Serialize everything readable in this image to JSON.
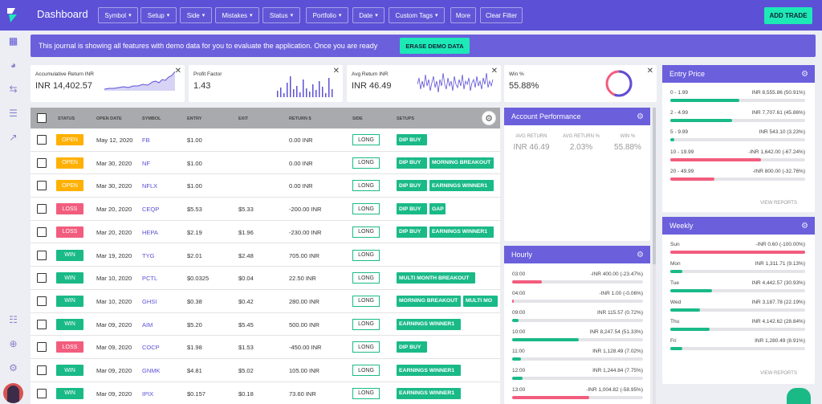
{
  "header": {
    "title": "Dashboard",
    "nav": [
      "Symbol",
      "Setup",
      "Side",
      "Mistakes",
      "Status",
      "Portfolio",
      "Date",
      "Custom Tags",
      "More",
      "Clear Filter"
    ],
    "add_trade": "ADD TRADE"
  },
  "banner": {
    "text": "This journal is showing all features with demo data for you to evaluate the application. Once you are ready",
    "button": "ERASE DEMO DATA"
  },
  "widgets": [
    {
      "label": "Accumulative Return INR",
      "value": "INR 14,402.57"
    },
    {
      "label": "Profit Factor",
      "value": "1.43"
    },
    {
      "label": "Avg Return INR",
      "value": "INR 46.49"
    },
    {
      "label": "Win %",
      "value": "55.88%"
    }
  ],
  "win_pct": 55.88,
  "table": {
    "headers": [
      "STATUS",
      "OPEN DATE",
      "SYMBOL",
      "ENTRY",
      "EXIT",
      "RETURN $",
      "SIDE",
      "SETUPS"
    ],
    "rows": [
      {
        "status": "OPEN",
        "date": "May 12, 2020",
        "symbol": "FB",
        "entry": "$1.00",
        "exit": "",
        "ret": "0.00 INR",
        "side": "LONG",
        "setups": [
          "DIP BUY"
        ]
      },
      {
        "status": "OPEN",
        "date": "Mar 30, 2020",
        "symbol": "NF",
        "entry": "$1.00",
        "exit": "",
        "ret": "0.00 INR",
        "side": "LONG",
        "setups": [
          "DIP BUY",
          "MORNING BREAKOUT"
        ]
      },
      {
        "status": "OPEN",
        "date": "Mar 30, 2020",
        "symbol": "NFLX",
        "entry": "$1.00",
        "exit": "",
        "ret": "0.00 INR",
        "side": "LONG",
        "setups": [
          "DIP BUY",
          "EARNINGS WINNER1"
        ]
      },
      {
        "status": "LOSS",
        "date": "Mar 20, 2020",
        "symbol": "CEQP",
        "entry": "$5.53",
        "exit": "$5.33",
        "ret": "-200.00 INR",
        "side": "LONG",
        "setups": [
          "DIP BUY",
          "GAP"
        ]
      },
      {
        "status": "LOSS",
        "date": "Mar 20, 2020",
        "symbol": "HEPA",
        "entry": "$2.19",
        "exit": "$1.96",
        "ret": "-230.00 INR",
        "side": "LONG",
        "setups": [
          "DIP BUY",
          "EARNINGS WINNER1"
        ]
      },
      {
        "status": "WIN",
        "date": "Mar 19, 2020",
        "symbol": "TYG",
        "entry": "$2.01",
        "exit": "$2.48",
        "ret": "705.00 INR",
        "side": "LONG",
        "setups": []
      },
      {
        "status": "WIN",
        "date": "Mar 10, 2020",
        "symbol": "PCTL",
        "entry": "$0.0325",
        "exit": "$0.04",
        "ret": "22.50 INR",
        "side": "LONG",
        "setups": [
          "MULTI MONTH BREAKOUT"
        ]
      },
      {
        "status": "WIN",
        "date": "Mar 10, 2020",
        "symbol": "GHSI",
        "entry": "$0.38",
        "exit": "$0.42",
        "ret": "280.00 INR",
        "side": "LONG",
        "setups": [
          "MORNING BREAKOUT",
          "MULTI MO"
        ]
      },
      {
        "status": "WIN",
        "date": "Mar 09, 2020",
        "symbol": "AIM",
        "entry": "$5.20",
        "exit": "$5.45",
        "ret": "500.00 INR",
        "side": "LONG",
        "setups": [
          "EARNINGS WINNER1"
        ]
      },
      {
        "status": "LOSS",
        "date": "Mar 09, 2020",
        "symbol": "COCP",
        "entry": "$1.98",
        "exit": "$1.53",
        "ret": "-450.00 INR",
        "side": "LONG",
        "setups": [
          "DIP BUY"
        ]
      },
      {
        "status": "WIN",
        "date": "Mar 09, 2020",
        "symbol": "GNMK",
        "entry": "$4.81",
        "exit": "$5.02",
        "ret": "105.00 INR",
        "side": "LONG",
        "setups": [
          "EARNINGS WINNER1"
        ]
      },
      {
        "status": "WIN",
        "date": "Mar 09, 2020",
        "symbol": "IPIX",
        "entry": "$0.157",
        "exit": "$0.18",
        "ret": "73.60 INR",
        "side": "LONG",
        "setups": [
          "EARNINGS WINNER1"
        ]
      }
    ]
  },
  "account_performance": {
    "title": "Account Performance",
    "stats": [
      {
        "label": "AVG RETURN",
        "value": "INR 46.49"
      },
      {
        "label": "AVG RETURN %",
        "value": "2.03%"
      },
      {
        "label": "WIN %",
        "value": "55.88%"
      }
    ]
  },
  "hourly": {
    "title": "Hourly",
    "rows": [
      {
        "label": "03:00",
        "value": "-INR 400.00 (-23.47%)",
        "pct": 0.23,
        "neg": true
      },
      {
        "label": "04:00",
        "value": "-INR 1.00 (-0.06%)",
        "pct": 0.01,
        "neg": true
      },
      {
        "label": "09:00",
        "value": "INR 115.57 (0.72%)",
        "pct": 0.05,
        "neg": false
      },
      {
        "label": "10:00",
        "value": "INR 8,247.54 (51.33%)",
        "pct": 0.51,
        "neg": false
      },
      {
        "label": "11:00",
        "value": "INR 1,128.49 (7.02%)",
        "pct": 0.07,
        "neg": false
      },
      {
        "label": "12:00",
        "value": "INR 1,244.84 (7.75%)",
        "pct": 0.08,
        "neg": false
      },
      {
        "label": "13:00",
        "value": "-INR 1,004.82 (-58.95%)",
        "pct": 0.59,
        "neg": true
      }
    ]
  },
  "entry_price": {
    "title": "Entry Price",
    "rows": [
      {
        "label": "0 - 1.99",
        "value": "INR 8,555.86 (50.91%)",
        "pct": 0.51,
        "neg": false
      },
      {
        "label": "2 - 4.99",
        "value": "INR 7,707.61 (45.86%)",
        "pct": 0.46,
        "neg": false
      },
      {
        "label": "5 - 9.99",
        "value": "INR 543.10 (3.23%)",
        "pct": 0.03,
        "neg": false
      },
      {
        "label": "10 - 19.99",
        "value": "-INR 1,642.00 (-67.24%)",
        "pct": 0.67,
        "neg": true
      },
      {
        "label": "20 - 49.99",
        "value": "-INR 800.00 (-32.76%)",
        "pct": 0.33,
        "neg": true
      }
    ],
    "view_reports": "VIEW REPORTS"
  },
  "weekly": {
    "title": "Weekly",
    "rows": [
      {
        "label": "Sun",
        "value": "-INR 0.60 (-100.00%)",
        "pct": 1.0,
        "neg": true
      },
      {
        "label": "Mon",
        "value": "INR 1,311.71 (9.13%)",
        "pct": 0.09,
        "neg": false
      },
      {
        "label": "Tue",
        "value": "INR 4,442.57 (30.93%)",
        "pct": 0.31,
        "neg": false
      },
      {
        "label": "Wed",
        "value": "INR 3,187.78 (22.19%)",
        "pct": 0.22,
        "neg": false
      },
      {
        "label": "Thu",
        "value": "INR 4,142.62 (28.84%)",
        "pct": 0.29,
        "neg": false
      },
      {
        "label": "Fri",
        "value": "INR 1,280.49 (8.91%)",
        "pct": 0.09,
        "neg": false
      }
    ],
    "view_reports": "VIEW REPORTS"
  },
  "colors": {
    "accent": "#5b50d6",
    "green": "#1aba87",
    "red": "#f25d7e",
    "open": "#ffb000",
    "teal": "#1de9b6"
  }
}
